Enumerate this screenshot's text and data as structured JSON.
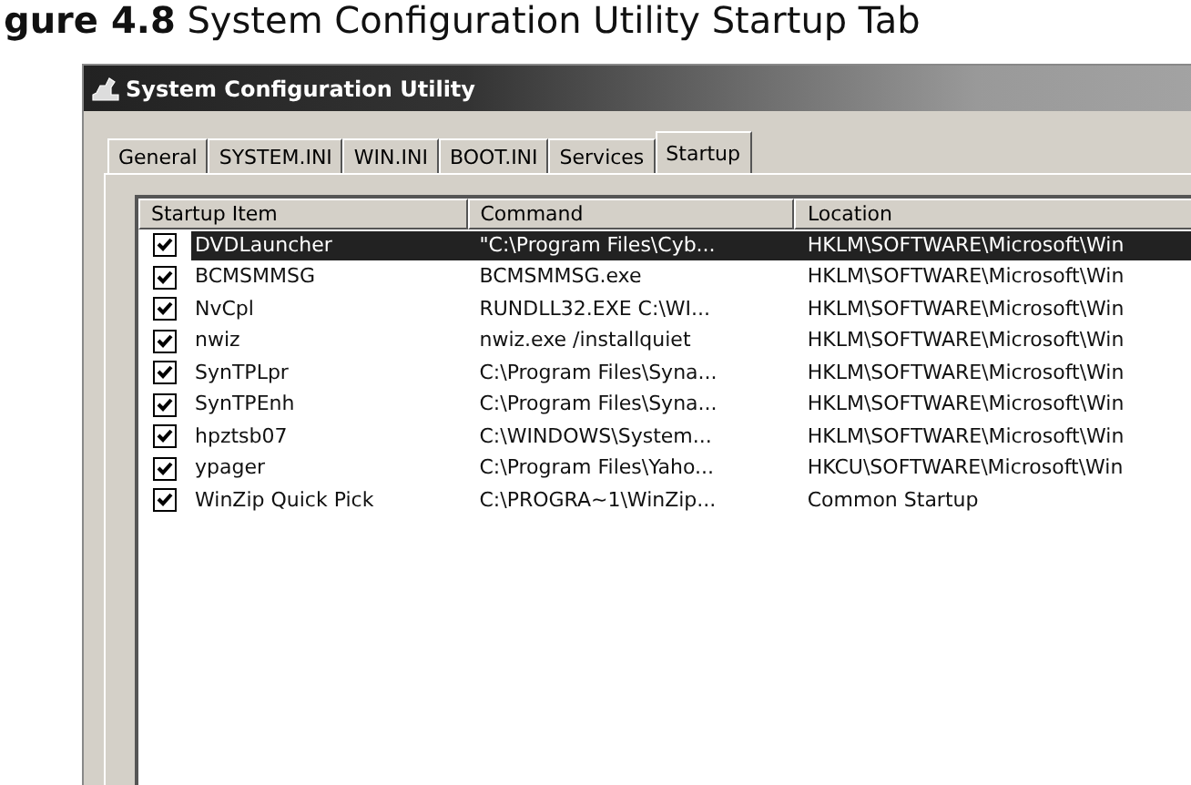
{
  "caption": "**gure 4.8** System Configuration Utility Startup Tab",
  "window": {
    "title": "System Configuration Utility"
  },
  "tabs": [
    {
      "label": "General",
      "selected": false
    },
    {
      "label": "SYSTEM.INI",
      "selected": false
    },
    {
      "label": "WIN.INI",
      "selected": false
    },
    {
      "label": "BOOT.INI",
      "selected": false
    },
    {
      "label": "Services",
      "selected": false
    },
    {
      "label": "Startup",
      "selected": true
    }
  ],
  "table": {
    "columns": [
      "Startup Item",
      "Command",
      "Location"
    ],
    "rows": [
      {
        "checked": true,
        "selected": true,
        "cells": [
          "DVDLauncher",
          "\"C:\\Program Files\\Cyb...",
          "HKLM\\SOFTWARE\\Microsoft\\Win"
        ]
      },
      {
        "checked": true,
        "selected": false,
        "cells": [
          "BCMSMMSG",
          "BCMSMMSG.exe",
          "HKLM\\SOFTWARE\\Microsoft\\Win"
        ]
      },
      {
        "checked": true,
        "selected": false,
        "cells": [
          "NvCpl",
          "RUNDLL32.EXE C:\\WI...",
          "HKLM\\SOFTWARE\\Microsoft\\Win"
        ]
      },
      {
        "checked": true,
        "selected": false,
        "cells": [
          "nwiz",
          "nwiz.exe /installquiet",
          "HKLM\\SOFTWARE\\Microsoft\\Win"
        ]
      },
      {
        "checked": true,
        "selected": false,
        "cells": [
          "SynTPLpr",
          "C:\\Program Files\\Syna...",
          "HKLM\\SOFTWARE\\Microsoft\\Win"
        ]
      },
      {
        "checked": true,
        "selected": false,
        "cells": [
          "SynTPEnh",
          "C:\\Program Files\\Syna...",
          "HKLM\\SOFTWARE\\Microsoft\\Win"
        ]
      },
      {
        "checked": true,
        "selected": false,
        "cells": [
          "hpztsb07",
          "C:\\WINDOWS\\System...",
          "HKLM\\SOFTWARE\\Microsoft\\Win"
        ]
      },
      {
        "checked": true,
        "selected": false,
        "cells": [
          "ypager",
          "C:\\Program Files\\Yaho...",
          "HKCU\\SOFTWARE\\Microsoft\\Win"
        ]
      },
      {
        "checked": true,
        "selected": false,
        "cells": [
          "WinZip Quick Pick",
          "C:\\PROGRA~1\\WinZip...",
          "Common Startup"
        ]
      }
    ]
  }
}
